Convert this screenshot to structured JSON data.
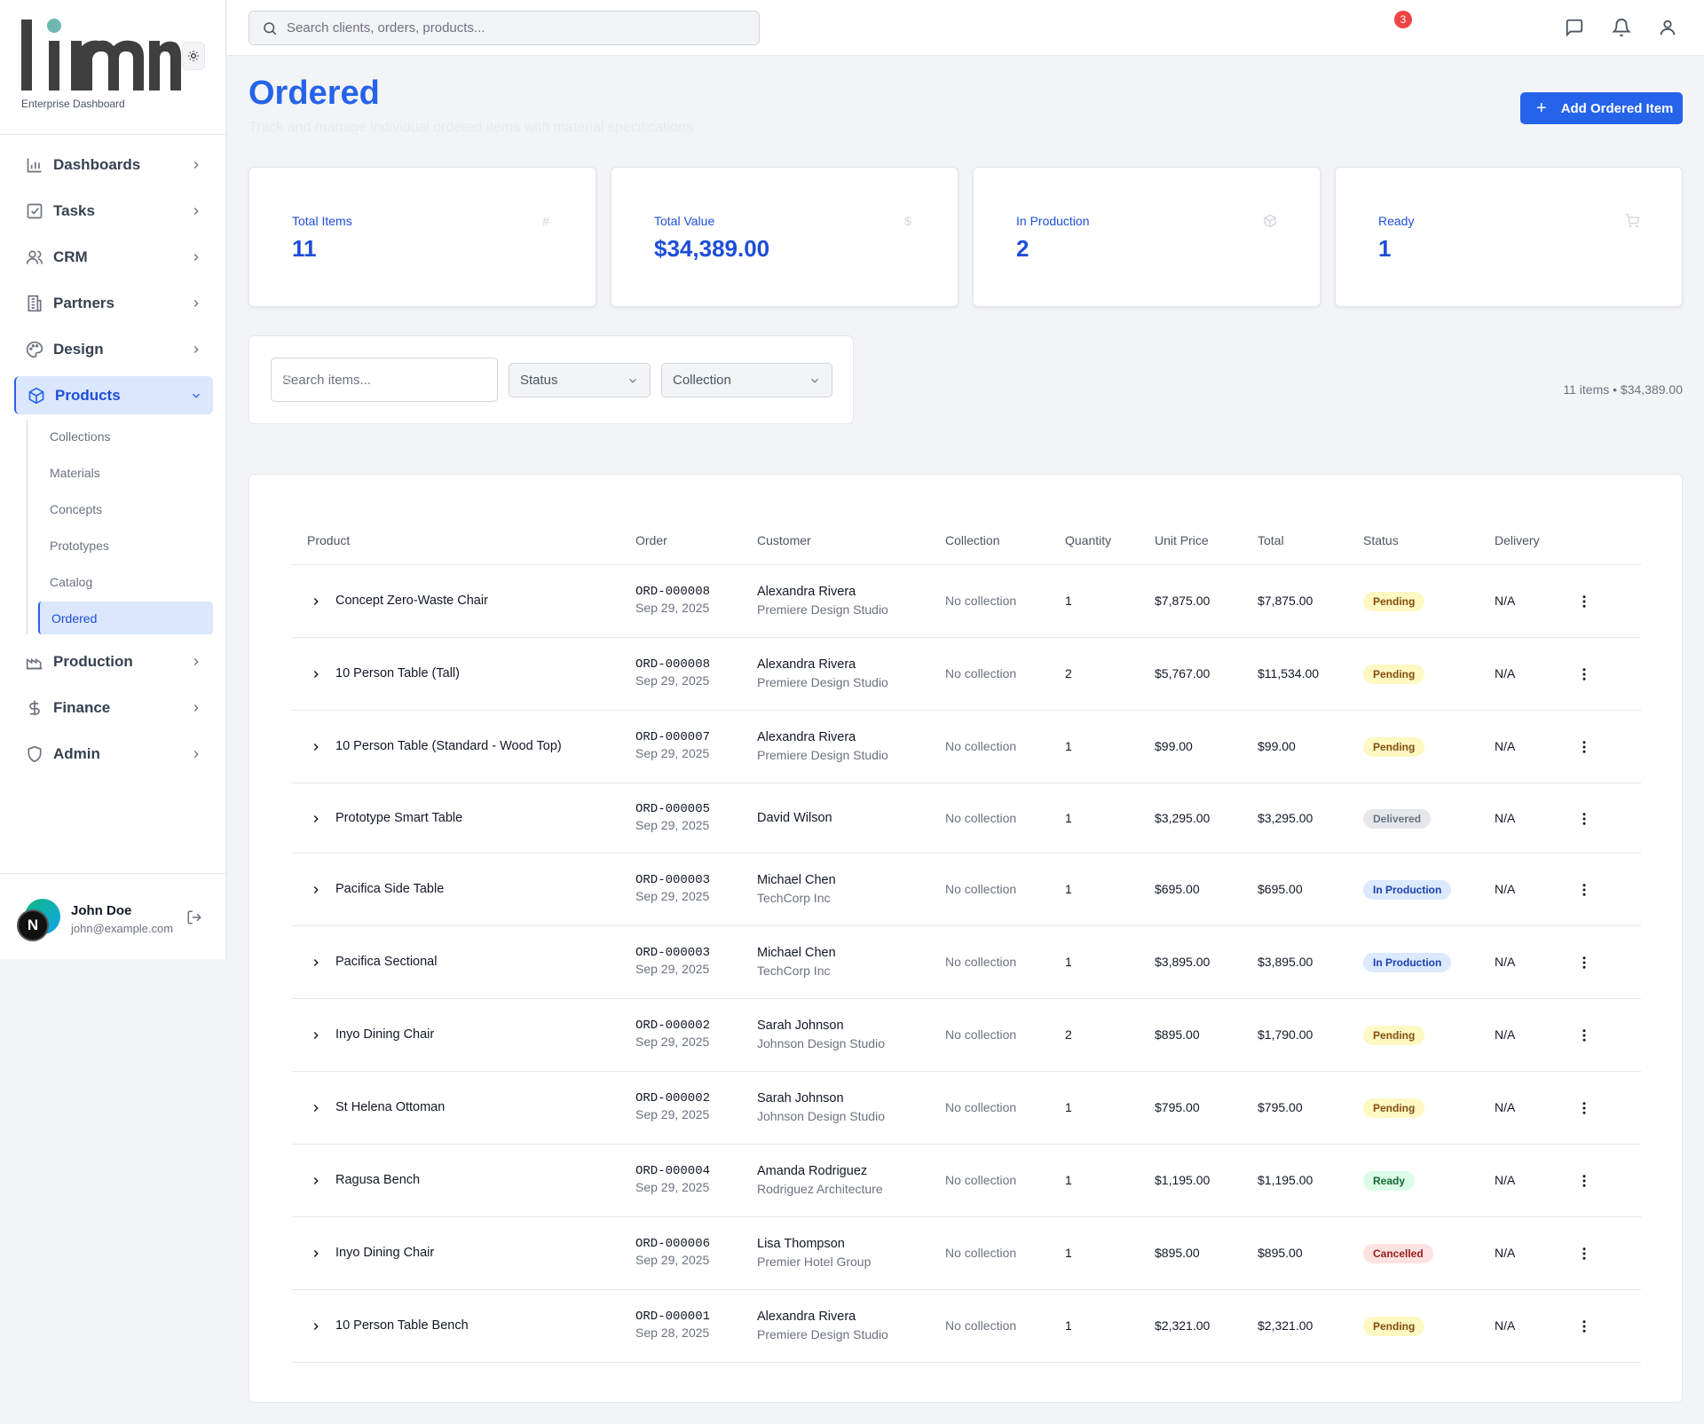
{
  "brand": {
    "logo_text": "limn",
    "subtitle": "Enterprise Dashboard"
  },
  "sidebar": {
    "items": [
      {
        "label": "Dashboards",
        "icon": "bar-chart-icon"
      },
      {
        "label": "Tasks",
        "icon": "checkbox-icon"
      },
      {
        "label": "CRM",
        "icon": "users-icon"
      },
      {
        "label": "Partners",
        "icon": "building-icon"
      },
      {
        "label": "Design",
        "icon": "palette-icon"
      },
      {
        "label": "Products",
        "icon": "box-icon",
        "active": true
      },
      {
        "label": "Production",
        "icon": "factory-icon"
      },
      {
        "label": "Finance",
        "icon": "dollar-icon"
      },
      {
        "label": "Admin",
        "icon": "shield-icon"
      }
    ],
    "products_sub": [
      "Collections",
      "Materials",
      "Concepts",
      "Prototypes",
      "Catalog",
      "Ordered"
    ],
    "active_sub": "Ordered"
  },
  "user": {
    "initial": "N",
    "name": "John Doe",
    "email": "john@example.com"
  },
  "topbar": {
    "search_placeholder": "Search clients, orders, products...",
    "notification_count": "3"
  },
  "page": {
    "title": "Ordered",
    "subtitle": "Track and manage individual ordered items with material specifications",
    "add_button": "Add Ordered Item"
  },
  "stats": [
    {
      "label": "Total Items",
      "value": "11",
      "icon": "#"
    },
    {
      "label": "Total Value",
      "value": "$34,389.00",
      "icon": "$"
    },
    {
      "label": "In Production",
      "value": "2",
      "icon": "package-icon"
    },
    {
      "label": "Ready",
      "value": "1",
      "icon": "cart-icon"
    }
  ],
  "filters": {
    "search_placeholder": "Search items...",
    "status": "Status",
    "collection": "Collection",
    "summary": "11 items • $34,389.00"
  },
  "table": {
    "headers": [
      "Product",
      "Order",
      "Customer",
      "Collection",
      "Quantity",
      "Unit Price",
      "Total",
      "Status",
      "Delivery"
    ],
    "rows": [
      {
        "product": "Concept Zero-Waste Chair",
        "order": "ORD-000008",
        "date": "Sep 29, 2025",
        "customer": "Alexandra Rivera",
        "company": "Premiere Design Studio",
        "collection": "No collection",
        "quantity": "1",
        "unit_price": "$7,875.00",
        "total": "$7,875.00",
        "status": "Pending",
        "delivery": "N/A"
      },
      {
        "product": "10 Person Table (Tall)",
        "order": "ORD-000008",
        "date": "Sep 29, 2025",
        "customer": "Alexandra Rivera",
        "company": "Premiere Design Studio",
        "collection": "No collection",
        "quantity": "2",
        "unit_price": "$5,767.00",
        "total": "$11,534.00",
        "status": "Pending",
        "delivery": "N/A"
      },
      {
        "product": "10 Person Table (Standard - Wood Top)",
        "order": "ORD-000007",
        "date": "Sep 29, 2025",
        "customer": "Alexandra Rivera",
        "company": "Premiere Design Studio",
        "collection": "No collection",
        "quantity": "1",
        "unit_price": "$99.00",
        "total": "$99.00",
        "status": "Pending",
        "delivery": "N/A"
      },
      {
        "product": "Prototype Smart Table",
        "order": "ORD-000005",
        "date": "Sep 29, 2025",
        "customer": "David Wilson",
        "company": "",
        "collection": "No collection",
        "quantity": "1",
        "unit_price": "$3,295.00",
        "total": "$3,295.00",
        "status": "Delivered",
        "delivery": "N/A"
      },
      {
        "product": "Pacifica Side Table",
        "order": "ORD-000003",
        "date": "Sep 29, 2025",
        "customer": "Michael Chen",
        "company": "TechCorp Inc",
        "collection": "No collection",
        "quantity": "1",
        "unit_price": "$695.00",
        "total": "$695.00",
        "status": "In Production",
        "delivery": "N/A"
      },
      {
        "product": "Pacifica Sectional",
        "order": "ORD-000003",
        "date": "Sep 29, 2025",
        "customer": "Michael Chen",
        "company": "TechCorp Inc",
        "collection": "No collection",
        "quantity": "1",
        "unit_price": "$3,895.00",
        "total": "$3,895.00",
        "status": "In Production",
        "delivery": "N/A"
      },
      {
        "product": "Inyo Dining Chair",
        "order": "ORD-000002",
        "date": "Sep 29, 2025",
        "customer": "Sarah Johnson",
        "company": "Johnson Design Studio",
        "collection": "No collection",
        "quantity": "2",
        "unit_price": "$895.00",
        "total": "$1,790.00",
        "status": "Pending",
        "delivery": "N/A"
      },
      {
        "product": "St Helena Ottoman",
        "order": "ORD-000002",
        "date": "Sep 29, 2025",
        "customer": "Sarah Johnson",
        "company": "Johnson Design Studio",
        "collection": "No collection",
        "quantity": "1",
        "unit_price": "$795.00",
        "total": "$795.00",
        "status": "Pending",
        "delivery": "N/A"
      },
      {
        "product": "Ragusa Bench",
        "order": "ORD-000004",
        "date": "Sep 29, 2025",
        "customer": "Amanda Rodriguez",
        "company": "Rodriguez Architecture",
        "collection": "No collection",
        "quantity": "1",
        "unit_price": "$1,195.00",
        "total": "$1,195.00",
        "status": "Ready",
        "delivery": "N/A"
      },
      {
        "product": "Inyo Dining Chair",
        "order": "ORD-000006",
        "date": "Sep 29, 2025",
        "customer": "Lisa Thompson",
        "company": "Premier Hotel Group",
        "collection": "No collection",
        "quantity": "1",
        "unit_price": "$895.00",
        "total": "$895.00",
        "status": "Cancelled",
        "delivery": "N/A"
      },
      {
        "product": "10 Person Table Bench",
        "order": "ORD-000001",
        "date": "Sep 28, 2025",
        "customer": "Alexandra Rivera",
        "company": "Premiere Design Studio",
        "collection": "No collection",
        "quantity": "1",
        "unit_price": "$2,321.00",
        "total": "$2,321.00",
        "status": "Pending",
        "delivery": "N/A"
      }
    ]
  },
  "colors": {
    "accent": "#2563eb",
    "pending": "#fef9c3",
    "delivered": "#e5e7eb",
    "in_production": "#dbeafe",
    "ready": "#dcfce7",
    "cancelled": "#fee2e2"
  }
}
